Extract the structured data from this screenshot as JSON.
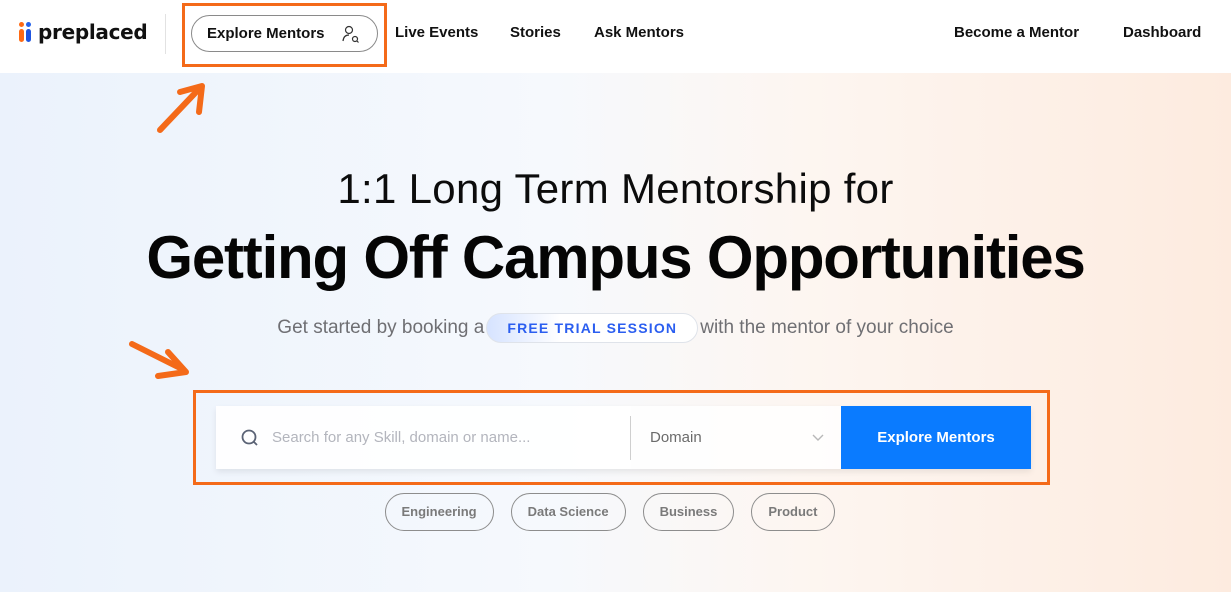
{
  "header": {
    "logo_text": "preplaced",
    "nav": {
      "explore_mentors": "Explore Mentors",
      "live_events": "Live Events",
      "stories": "Stories",
      "ask_mentors": "Ask Mentors",
      "become_mentor": "Become a Mentor",
      "dashboard": "Dashboard"
    }
  },
  "hero": {
    "subtitle": "1:1 Long Term Mentorship for",
    "title": "Getting Off Campus Opportunities",
    "tagline_before": "Get started by booking a",
    "trial_badge": "FREE TRIAL SESSION",
    "tagline_after": "with the mentor of your choice"
  },
  "search": {
    "placeholder": "Search for any Skill, domain or name...",
    "value": "",
    "domain_selected": "Domain",
    "button_label": "Explore Mentors"
  },
  "categories": [
    "Engineering",
    "Data Science",
    "Business",
    "Product"
  ],
  "colors": {
    "accent_blue": "#0a7bff",
    "badge_blue": "#2b5ef0",
    "annotation_orange": "#f46a19"
  },
  "annotations": {
    "icons": [
      "arrow-up-right-icon",
      "arrow-down-right-icon"
    ]
  }
}
